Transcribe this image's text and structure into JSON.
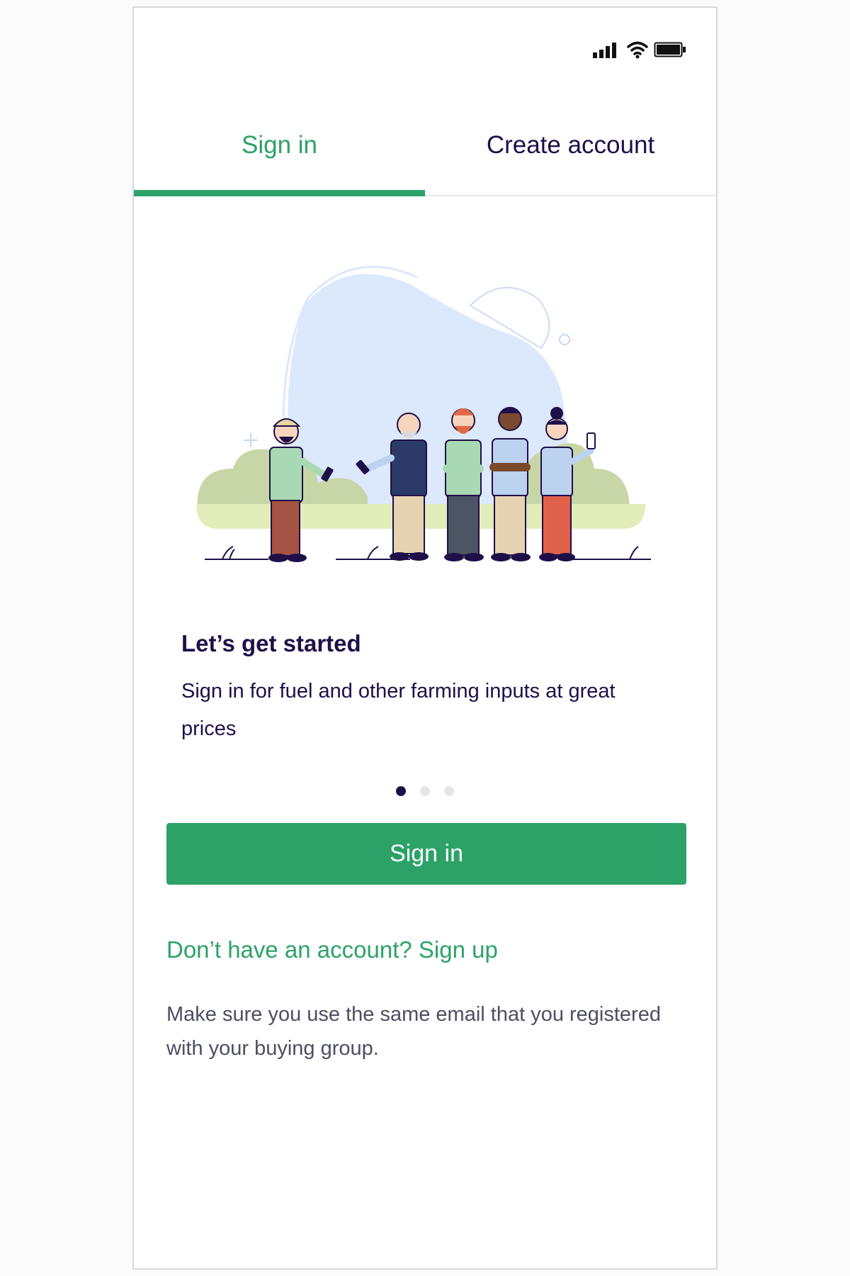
{
  "status_bar": {
    "icons": [
      "signal-icon",
      "wifi-icon",
      "battery-icon"
    ]
  },
  "tabs": [
    {
      "label": "Sign in",
      "active": true
    },
    {
      "label": "Create account",
      "active": false
    }
  ],
  "carousel": {
    "title": "Let’s get started",
    "description": "Sign in for fuel and other farming inputs at great prices",
    "page_count": 3,
    "current_page": 1
  },
  "primary_button": {
    "label": "Sign in"
  },
  "signup_link": {
    "label": "Don’t have an account? Sign up"
  },
  "note": "Make sure you use the same email that you registered with your buying group.",
  "colors": {
    "accent": "#2ca268",
    "text_dark": "#1f0f49",
    "text_muted": "#4c4f63",
    "blob": "#dce8fc",
    "bush": "#c7d6a6",
    "grass": "#e2edba"
  }
}
